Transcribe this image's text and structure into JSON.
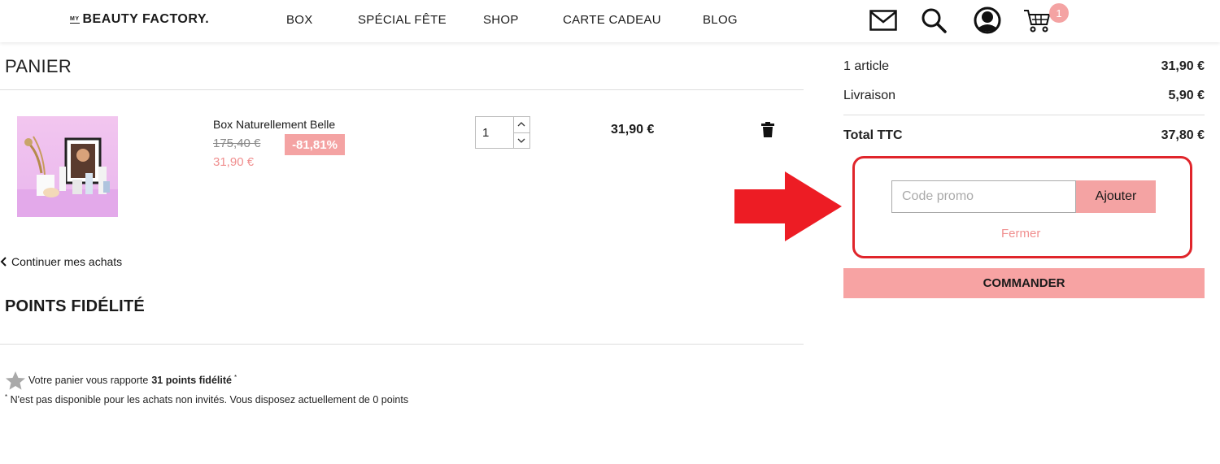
{
  "header": {
    "logo_prefix": "MY",
    "logo_text": "BEAUTY FACTORY.",
    "nav": [
      "BOX",
      "SPÉCIAL FÊTE",
      "SHOP",
      "CARTE CADEAU",
      "BLOG"
    ],
    "cart_count": "1"
  },
  "cart": {
    "title": "PANIER",
    "item": {
      "name": "Box Naturellement Belle",
      "old_price": "175,40 €",
      "discount": "-81,81%",
      "price": "31,90 €",
      "quantity": "1",
      "line_total": "31,90 €"
    },
    "continue_label": "Continuer mes achats"
  },
  "loyalty": {
    "title": "POINTS FIDÉLITÉ",
    "line_prefix": "Votre panier vous rapporte",
    "points_text": "31 points fidélité",
    "asterisk": "*",
    "note": "N'est pas disponible pour les achats non invités. Vous disposez actuellement de 0 points"
  },
  "summary": {
    "items_label": "1 article",
    "items_value": "31,90 €",
    "shipping_label": "Livraison",
    "shipping_value": "5,90 €",
    "total_label": "Total TTC",
    "total_value": "37,80 €",
    "promo_placeholder": "Code promo",
    "promo_button": "Ajouter",
    "close_label": "Fermer",
    "checkout_label": "COMMANDER"
  },
  "colors": {
    "accent_pink": "#f4a3a3",
    "annotation_red": "#e0252b"
  }
}
